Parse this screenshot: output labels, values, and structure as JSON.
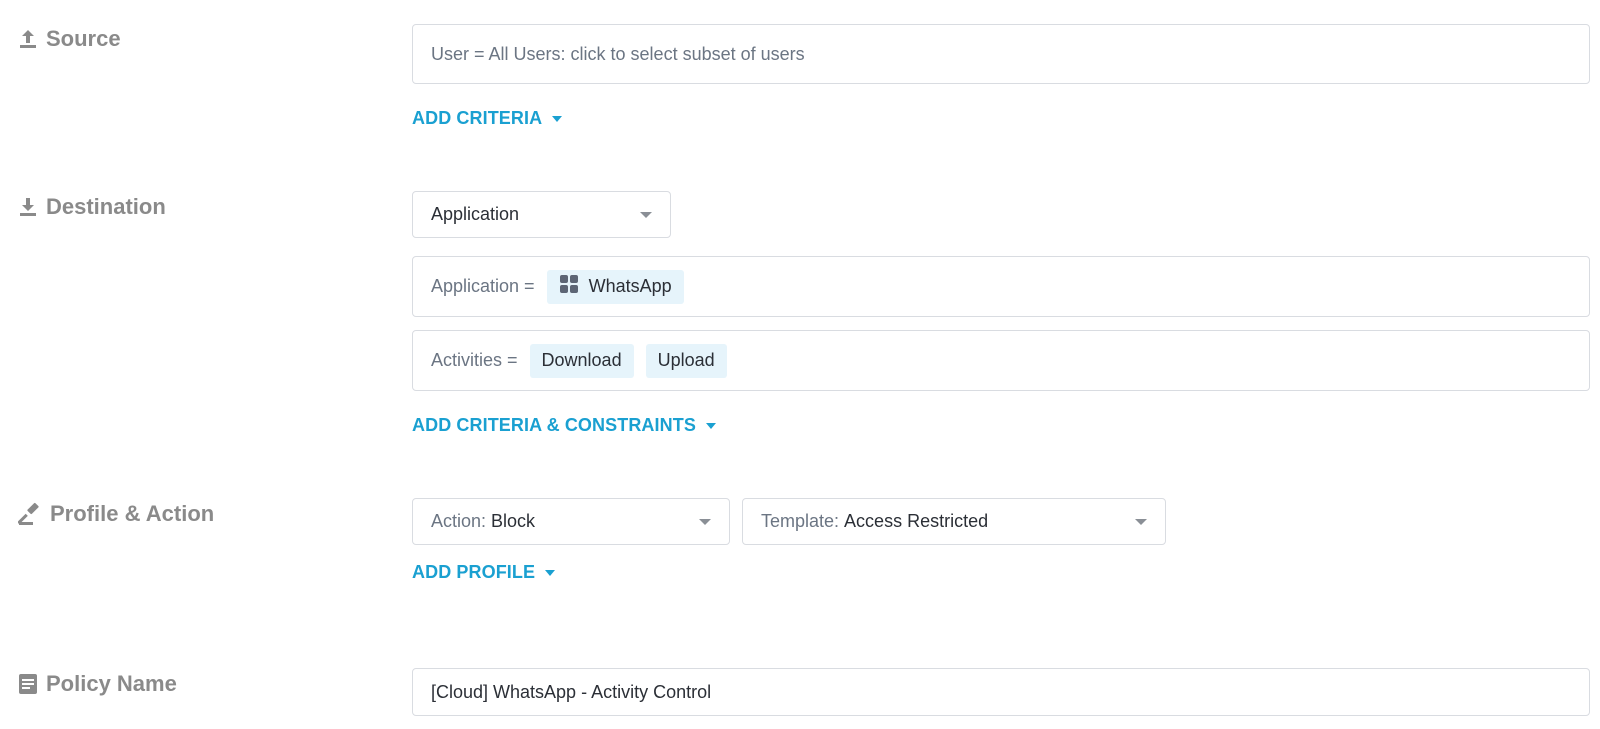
{
  "source": {
    "label": "Source",
    "icon": "upload-icon",
    "user_field_text": "User = All Users: click to select subset of users",
    "add_criteria": "ADD CRITERIA"
  },
  "destination": {
    "label": "Destination",
    "icon": "download-icon",
    "type_select": "Application",
    "application_label": "Application =",
    "application_chip": "WhatsApp",
    "activities_label": "Activities =",
    "activities": [
      "Download",
      "Upload"
    ],
    "add_criteria": "ADD CRITERIA & CONSTRAINTS"
  },
  "profile_action": {
    "label": "Profile & Action",
    "icon": "gavel-icon",
    "action_prefix": "Action:",
    "action_value": "Block",
    "template_prefix": "Template:",
    "template_value": "Access Restricted",
    "add_profile": "ADD PROFILE"
  },
  "policy_name": {
    "label": "Policy Name",
    "icon": "document-icon",
    "value": "[Cloud] WhatsApp - Activity Control"
  },
  "colors": {
    "accent": "#1aa0d1",
    "label_gray": "#8a8a8a",
    "chip_bg": "#e6f4fb",
    "border": "#d9dce1"
  }
}
